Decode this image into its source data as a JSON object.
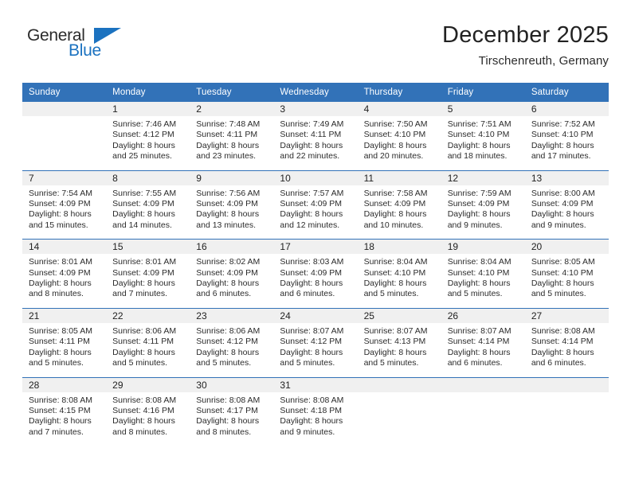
{
  "brand": {
    "name_part1": "General",
    "name_part2": "Blue",
    "triangle_color": "#1b72c0"
  },
  "header": {
    "title": "December 2025",
    "subtitle": "Tirschenreuth, Germany",
    "header_bg_color": "#3272b8",
    "daynum_bg_color": "#f0f0f0"
  },
  "weekday_headers": [
    "Sunday",
    "Monday",
    "Tuesday",
    "Wednesday",
    "Thursday",
    "Friday",
    "Saturday"
  ],
  "weeks": [
    [
      {
        "day": "",
        "lines": []
      },
      {
        "day": "1",
        "lines": [
          "Sunrise: 7:46 AM",
          "Sunset: 4:12 PM",
          "Daylight: 8 hours",
          "and 25 minutes."
        ]
      },
      {
        "day": "2",
        "lines": [
          "Sunrise: 7:48 AM",
          "Sunset: 4:11 PM",
          "Daylight: 8 hours",
          "and 23 minutes."
        ]
      },
      {
        "day": "3",
        "lines": [
          "Sunrise: 7:49 AM",
          "Sunset: 4:11 PM",
          "Daylight: 8 hours",
          "and 22 minutes."
        ]
      },
      {
        "day": "4",
        "lines": [
          "Sunrise: 7:50 AM",
          "Sunset: 4:10 PM",
          "Daylight: 8 hours",
          "and 20 minutes."
        ]
      },
      {
        "day": "5",
        "lines": [
          "Sunrise: 7:51 AM",
          "Sunset: 4:10 PM",
          "Daylight: 8 hours",
          "and 18 minutes."
        ]
      },
      {
        "day": "6",
        "lines": [
          "Sunrise: 7:52 AM",
          "Sunset: 4:10 PM",
          "Daylight: 8 hours",
          "and 17 minutes."
        ]
      }
    ],
    [
      {
        "day": "7",
        "lines": [
          "Sunrise: 7:54 AM",
          "Sunset: 4:09 PM",
          "Daylight: 8 hours",
          "and 15 minutes."
        ]
      },
      {
        "day": "8",
        "lines": [
          "Sunrise: 7:55 AM",
          "Sunset: 4:09 PM",
          "Daylight: 8 hours",
          "and 14 minutes."
        ]
      },
      {
        "day": "9",
        "lines": [
          "Sunrise: 7:56 AM",
          "Sunset: 4:09 PM",
          "Daylight: 8 hours",
          "and 13 minutes."
        ]
      },
      {
        "day": "10",
        "lines": [
          "Sunrise: 7:57 AM",
          "Sunset: 4:09 PM",
          "Daylight: 8 hours",
          "and 12 minutes."
        ]
      },
      {
        "day": "11",
        "lines": [
          "Sunrise: 7:58 AM",
          "Sunset: 4:09 PM",
          "Daylight: 8 hours",
          "and 10 minutes."
        ]
      },
      {
        "day": "12",
        "lines": [
          "Sunrise: 7:59 AM",
          "Sunset: 4:09 PM",
          "Daylight: 8 hours",
          "and 9 minutes."
        ]
      },
      {
        "day": "13",
        "lines": [
          "Sunrise: 8:00 AM",
          "Sunset: 4:09 PM",
          "Daylight: 8 hours",
          "and 9 minutes."
        ]
      }
    ],
    [
      {
        "day": "14",
        "lines": [
          "Sunrise: 8:01 AM",
          "Sunset: 4:09 PM",
          "Daylight: 8 hours",
          "and 8 minutes."
        ]
      },
      {
        "day": "15",
        "lines": [
          "Sunrise: 8:01 AM",
          "Sunset: 4:09 PM",
          "Daylight: 8 hours",
          "and 7 minutes."
        ]
      },
      {
        "day": "16",
        "lines": [
          "Sunrise: 8:02 AM",
          "Sunset: 4:09 PM",
          "Daylight: 8 hours",
          "and 6 minutes."
        ]
      },
      {
        "day": "17",
        "lines": [
          "Sunrise: 8:03 AM",
          "Sunset: 4:09 PM",
          "Daylight: 8 hours",
          "and 6 minutes."
        ]
      },
      {
        "day": "18",
        "lines": [
          "Sunrise: 8:04 AM",
          "Sunset: 4:10 PM",
          "Daylight: 8 hours",
          "and 5 minutes."
        ]
      },
      {
        "day": "19",
        "lines": [
          "Sunrise: 8:04 AM",
          "Sunset: 4:10 PM",
          "Daylight: 8 hours",
          "and 5 minutes."
        ]
      },
      {
        "day": "20",
        "lines": [
          "Sunrise: 8:05 AM",
          "Sunset: 4:10 PM",
          "Daylight: 8 hours",
          "and 5 minutes."
        ]
      }
    ],
    [
      {
        "day": "21",
        "lines": [
          "Sunrise: 8:05 AM",
          "Sunset: 4:11 PM",
          "Daylight: 8 hours",
          "and 5 minutes."
        ]
      },
      {
        "day": "22",
        "lines": [
          "Sunrise: 8:06 AM",
          "Sunset: 4:11 PM",
          "Daylight: 8 hours",
          "and 5 minutes."
        ]
      },
      {
        "day": "23",
        "lines": [
          "Sunrise: 8:06 AM",
          "Sunset: 4:12 PM",
          "Daylight: 8 hours",
          "and 5 minutes."
        ]
      },
      {
        "day": "24",
        "lines": [
          "Sunrise: 8:07 AM",
          "Sunset: 4:12 PM",
          "Daylight: 8 hours",
          "and 5 minutes."
        ]
      },
      {
        "day": "25",
        "lines": [
          "Sunrise: 8:07 AM",
          "Sunset: 4:13 PM",
          "Daylight: 8 hours",
          "and 5 minutes."
        ]
      },
      {
        "day": "26",
        "lines": [
          "Sunrise: 8:07 AM",
          "Sunset: 4:14 PM",
          "Daylight: 8 hours",
          "and 6 minutes."
        ]
      },
      {
        "day": "27",
        "lines": [
          "Sunrise: 8:08 AM",
          "Sunset: 4:14 PM",
          "Daylight: 8 hours",
          "and 6 minutes."
        ]
      }
    ],
    [
      {
        "day": "28",
        "lines": [
          "Sunrise: 8:08 AM",
          "Sunset: 4:15 PM",
          "Daylight: 8 hours",
          "and 7 minutes."
        ]
      },
      {
        "day": "29",
        "lines": [
          "Sunrise: 8:08 AM",
          "Sunset: 4:16 PM",
          "Daylight: 8 hours",
          "and 8 minutes."
        ]
      },
      {
        "day": "30",
        "lines": [
          "Sunrise: 8:08 AM",
          "Sunset: 4:17 PM",
          "Daylight: 8 hours",
          "and 8 minutes."
        ]
      },
      {
        "day": "31",
        "lines": [
          "Sunrise: 8:08 AM",
          "Sunset: 4:18 PM",
          "Daylight: 8 hours",
          "and 9 minutes."
        ]
      },
      {
        "day": "",
        "lines": []
      },
      {
        "day": "",
        "lines": []
      },
      {
        "day": "",
        "lines": []
      }
    ]
  ]
}
